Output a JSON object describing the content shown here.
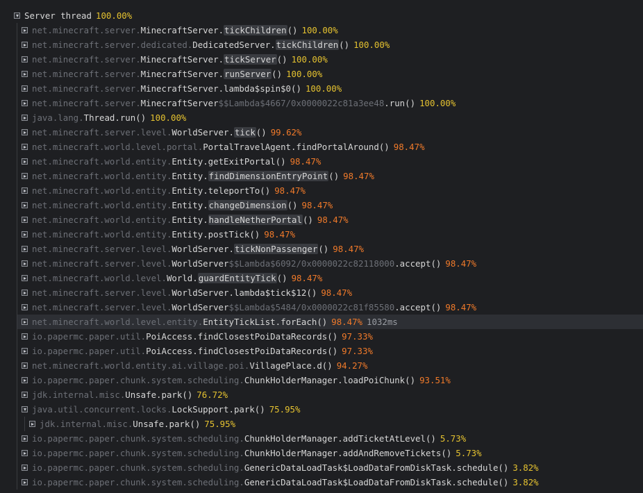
{
  "colors": {
    "yellow": "#e5c230",
    "orange": "#f07a2a"
  },
  "root": {
    "label": "Server thread",
    "pct": "100.00%",
    "color": "yellow"
  },
  "rows": [
    {
      "indent": 1,
      "pkg": "net.minecraft.server.",
      "cls": "MinecraftServer",
      "lam": "",
      "method": "tickChildren",
      "hl": true,
      "pct": "100.00%",
      "color": "yellow"
    },
    {
      "indent": 1,
      "pkg": "net.minecraft.server.dedicated.",
      "cls": "DedicatedServer",
      "lam": "",
      "method": "tickChildren",
      "hl": true,
      "pct": "100.00%",
      "color": "yellow"
    },
    {
      "indent": 1,
      "pkg": "net.minecraft.server.",
      "cls": "MinecraftServer",
      "lam": "",
      "method": "tickServer",
      "hl": true,
      "pct": "100.00%",
      "color": "yellow"
    },
    {
      "indent": 1,
      "pkg": "net.minecraft.server.",
      "cls": "MinecraftServer",
      "lam": "",
      "method": "runServer",
      "hl": true,
      "pct": "100.00%",
      "color": "yellow"
    },
    {
      "indent": 1,
      "pkg": "net.minecraft.server.",
      "cls": "MinecraftServer",
      "lam": "",
      "method": "lambda$spin$0",
      "hl": false,
      "pct": "100.00%",
      "color": "yellow"
    },
    {
      "indent": 1,
      "pkg": "net.minecraft.server.",
      "cls": "MinecraftServer",
      "lam": "$$Lambda$4667/0x0000022c81a3ee48",
      "method": "run",
      "hl": false,
      "pct": "100.00%",
      "color": "yellow"
    },
    {
      "indent": 1,
      "pkg": "java.lang.",
      "cls": "Thread",
      "lam": "",
      "method": "run",
      "hl": false,
      "pct": "100.00%",
      "color": "yellow"
    },
    {
      "indent": 1,
      "pkg": "net.minecraft.server.level.",
      "cls": "WorldServer",
      "lam": "",
      "method": "tick",
      "hl": true,
      "pct": "99.62%",
      "color": "orange"
    },
    {
      "indent": 1,
      "pkg": "net.minecraft.world.level.portal.",
      "cls": "PortalTravelAgent",
      "lam": "",
      "method": "findPortalAround",
      "hl": false,
      "pct": "98.47%",
      "color": "orange"
    },
    {
      "indent": 1,
      "pkg": "net.minecraft.world.entity.",
      "cls": "Entity",
      "lam": "",
      "method": "getExitPortal",
      "hl": false,
      "pct": "98.47%",
      "color": "orange"
    },
    {
      "indent": 1,
      "pkg": "net.minecraft.world.entity.",
      "cls": "Entity",
      "lam": "",
      "method": "findDimensionEntryPoint",
      "hl": true,
      "pct": "98.47%",
      "color": "orange"
    },
    {
      "indent": 1,
      "pkg": "net.minecraft.world.entity.",
      "cls": "Entity",
      "lam": "",
      "method": "teleportTo",
      "hl": false,
      "pct": "98.47%",
      "color": "orange"
    },
    {
      "indent": 1,
      "pkg": "net.minecraft.world.entity.",
      "cls": "Entity",
      "lam": "",
      "method": "changeDimension",
      "hl": true,
      "pct": "98.47%",
      "color": "orange"
    },
    {
      "indent": 1,
      "pkg": "net.minecraft.world.entity.",
      "cls": "Entity",
      "lam": "",
      "method": "handleNetherPortal",
      "hl": true,
      "pct": "98.47%",
      "color": "orange"
    },
    {
      "indent": 1,
      "pkg": "net.minecraft.world.entity.",
      "cls": "Entity",
      "lam": "",
      "method": "postTick",
      "hl": false,
      "pct": "98.47%",
      "color": "orange"
    },
    {
      "indent": 1,
      "pkg": "net.minecraft.server.level.",
      "cls": "WorldServer",
      "lam": "",
      "method": "tickNonPassenger",
      "hl": true,
      "pct": "98.47%",
      "color": "orange"
    },
    {
      "indent": 1,
      "pkg": "net.minecraft.server.level.",
      "cls": "WorldServer",
      "lam": "$$Lambda$6092/0x0000022c82118000",
      "method": "accept",
      "hl": false,
      "pct": "98.47%",
      "color": "orange"
    },
    {
      "indent": 1,
      "pkg": "net.minecraft.world.level.",
      "cls": "World",
      "lam": "",
      "method": "guardEntityTick",
      "hl": true,
      "pct": "98.47%",
      "color": "orange"
    },
    {
      "indent": 1,
      "pkg": "net.minecraft.server.level.",
      "cls": "WorldServer",
      "lam": "",
      "method": "lambda$tick$12",
      "hl": false,
      "pct": "98.47%",
      "color": "orange"
    },
    {
      "indent": 1,
      "pkg": "net.minecraft.server.level.",
      "cls": "WorldServer",
      "lam": "$$Lambda$5484/0x0000022c81f85580",
      "method": "accept",
      "hl": false,
      "pct": "98.47%",
      "color": "orange"
    },
    {
      "indent": 1,
      "pkg": "net.minecraft.world.level.entity.",
      "cls": "EntityTickList",
      "lam": "",
      "method": "forEach",
      "hl": false,
      "pct": "98.47%",
      "color": "orange",
      "time": "1032ms",
      "highlight": true
    },
    {
      "indent": 1,
      "pkg": "io.papermc.paper.util.",
      "cls": "PoiAccess",
      "lam": "",
      "method": "findClosestPoiDataRecords",
      "hl": false,
      "pct": "97.33%",
      "color": "orange"
    },
    {
      "indent": 1,
      "pkg": "io.papermc.paper.util.",
      "cls": "PoiAccess",
      "lam": "",
      "method": "findClosestPoiDataRecords",
      "hl": false,
      "pct": "97.33%",
      "color": "orange"
    },
    {
      "indent": 1,
      "pkg": "net.minecraft.world.entity.ai.village.poi.",
      "cls": "VillagePlace",
      "lam": "",
      "method": "d",
      "hl": false,
      "pct": "94.27%",
      "color": "orange"
    },
    {
      "indent": 1,
      "pkg": "io.papermc.paper.chunk.system.scheduling.",
      "cls": "ChunkHolderManager",
      "lam": "",
      "method": "loadPoiChunk",
      "hl": false,
      "pct": "93.51%",
      "color": "orange"
    },
    {
      "indent": 1,
      "pkg": "jdk.internal.misc.",
      "cls": "Unsafe",
      "lam": "",
      "method": "park",
      "hl": false,
      "pct": "76.72%",
      "color": "yellow"
    },
    {
      "indent": 1,
      "pkg": "java.util.concurrent.locks.",
      "cls": "LockSupport",
      "lam": "",
      "method": "park",
      "hl": false,
      "pct": "75.95%",
      "color": "yellow",
      "expanded": true
    },
    {
      "indent": 2,
      "pkg": "jdk.internal.misc.",
      "cls": "Unsafe",
      "lam": "",
      "method": "park",
      "hl": false,
      "pct": "75.95%",
      "color": "yellow"
    },
    {
      "indent": 1,
      "pkg": "io.papermc.paper.chunk.system.scheduling.",
      "cls": "ChunkHolderManager",
      "lam": "",
      "method": "addTicketAtLevel",
      "hl": false,
      "pct": "5.73%",
      "color": "yellow"
    },
    {
      "indent": 1,
      "pkg": "io.papermc.paper.chunk.system.scheduling.",
      "cls": "ChunkHolderManager",
      "lam": "",
      "method": "addAndRemoveTickets",
      "hl": false,
      "pct": "5.73%",
      "color": "yellow"
    },
    {
      "indent": 1,
      "pkg": "io.papermc.paper.chunk.system.scheduling.",
      "cls": "GenericDataLoadTask$LoadDataFromDiskTask",
      "lam": "",
      "method": "schedule",
      "hl": false,
      "pct": "3.82%",
      "color": "yellow"
    },
    {
      "indent": 1,
      "pkg": "io.papermc.paper.chunk.system.scheduling.",
      "cls": "GenericDataLoadTask$LoadDataFromDiskTask",
      "lam": "",
      "method": "schedule",
      "hl": false,
      "pct": "3.82%",
      "color": "yellow"
    }
  ]
}
